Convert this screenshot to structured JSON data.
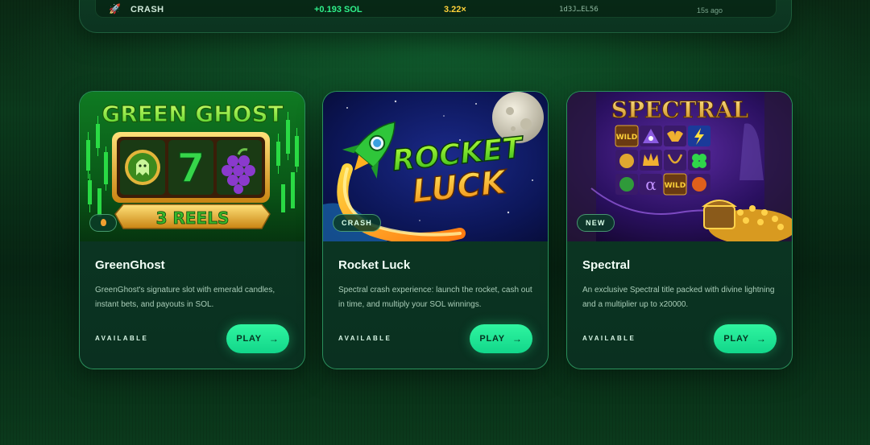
{
  "recent_bet": {
    "icon": "rocket-icon",
    "game": "CRASH",
    "amount": "+0.193 SOL",
    "multiplier": "3.22×",
    "user": "1d3J…EL56",
    "time": "15s ago"
  },
  "cards": [
    {
      "id": "greenghost",
      "art_title": "GREEN GHOST",
      "art_subtitle": "3 REELS",
      "art_reel": "7",
      "tag": "",
      "tag_icon": "flame-icon",
      "title": "GreenGhost",
      "description": "GreenGhost's signature slot with emerald candles, instant bets, and payouts in SOL.",
      "status": "AVAILABLE",
      "play_label": "PLAY",
      "play_arrow": "→"
    },
    {
      "id": "rocketluck",
      "art_title_line1": "ROCKET",
      "art_title_line2": "LUCK",
      "tag": "CRASH",
      "title": "Rocket Luck",
      "description": "Spectral crash experience: launch the rocket, cash out in time, and multiply your SOL winnings.",
      "status": "AVAILABLE",
      "play_label": "PLAY",
      "play_arrow": "→"
    },
    {
      "id": "spectral",
      "art_title": "SPECTRAL",
      "art_symbols": [
        "WILD",
        "α",
        "WILD"
      ],
      "tag": "NEW",
      "title": "Spectral",
      "description": "An exclusive Spectral title packed with divine lightning and a multiplier up to x20000.",
      "status": "AVAILABLE",
      "play_label": "PLAY",
      "play_arrow": "→"
    }
  ],
  "colors": {
    "accent": "#22e893",
    "card_border": "#46dc8c",
    "multiplier": "#ffd23a",
    "amount": "#2ff08a"
  }
}
